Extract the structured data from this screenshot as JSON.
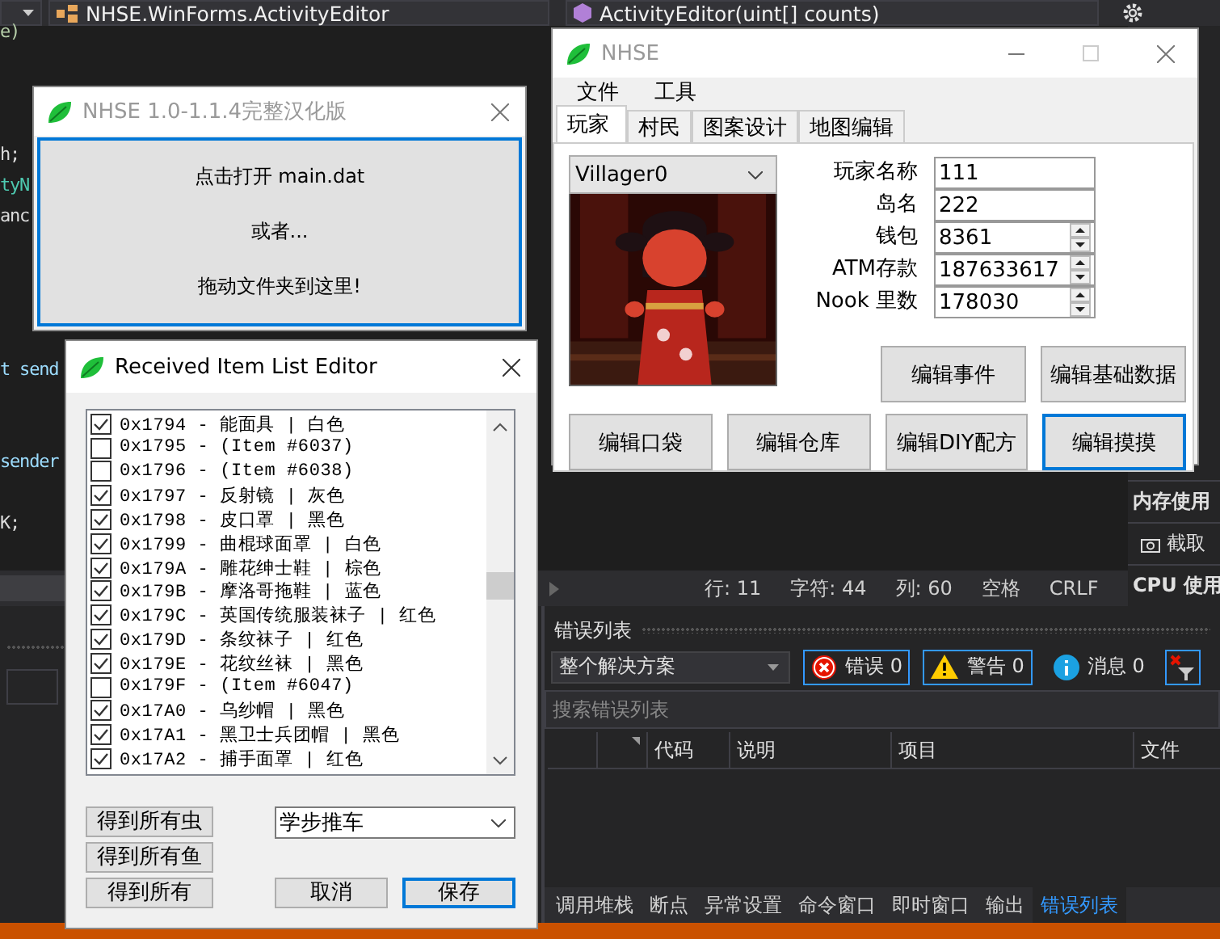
{
  "ide": {
    "nav": {
      "class_combo": "NHSE.WinForms.ActivityEditor",
      "member_combo": "ActivityEditor(uint[] counts)"
    },
    "code_fragments": [
      {
        "text": "e)",
        "kind": "number"
      },
      {
        "text": "h;",
        "kind": "plain"
      },
      {
        "text": "tyN",
        "kind": "type"
      },
      {
        "text": "anc",
        "kind": "plain"
      },
      {
        "text": "t send",
        "kind": "param"
      },
      {
        "text": "sender",
        "kind": "param"
      },
      {
        "text": "K;",
        "kind": "plain"
      }
    ],
    "diagnostics": [
      {
        "text": "内存使用",
        "kind": "header"
      },
      {
        "text": "截取",
        "kind": "action"
      },
      {
        "text": "CPU 使用",
        "kind": "header"
      }
    ],
    "status": [
      "行: 11",
      "字符: 44",
      "列: 60",
      "空格",
      "CRLF"
    ],
    "error_list": {
      "title": "错误列表",
      "scope": "整个解决方案",
      "filters": [
        {
          "kind": "error",
          "label": "错误 0",
          "selected": true
        },
        {
          "kind": "warning",
          "label": "警告 0",
          "selected": true
        },
        {
          "kind": "info",
          "label": "消息 0",
          "selected": false
        }
      ],
      "filter_toggle": {
        "selected": true
      },
      "search": {
        "placeholder": "搜索错误列表"
      },
      "columns": [
        "代码",
        "说明",
        "项目",
        "文件"
      ]
    },
    "bottom_tabs": [
      {
        "label": "调用堆栈",
        "selected": false
      },
      {
        "label": "断点",
        "selected": false
      },
      {
        "label": "异常设置",
        "selected": false
      },
      {
        "label": "命令窗口",
        "selected": false
      },
      {
        "label": "即时窗口",
        "selected": false
      },
      {
        "label": "输出",
        "selected": false
      },
      {
        "label": "错误列表",
        "selected": true
      }
    ]
  },
  "windows": {
    "start": {
      "title": "NHSE 1.0-1.1.4完整汉化版",
      "active": false,
      "lines": [
        "点击打开 main.dat",
        "或者...",
        "拖动文件夹到这里!"
      ]
    },
    "nhse": {
      "title": "NHSE",
      "active": false,
      "menu": [
        "文件",
        "工具"
      ],
      "tabs": [
        {
          "label": "玩家",
          "selected": true
        },
        {
          "label": "村民",
          "selected": false
        },
        {
          "label": "图案设计",
          "selected": false
        },
        {
          "label": "地图编辑",
          "selected": false
        }
      ],
      "villager": "Villager0",
      "fields": [
        {
          "label": "玩家名称",
          "value": "111",
          "kind": "text"
        },
        {
          "label": "岛名",
          "value": "222",
          "kind": "text"
        },
        {
          "label": "钱包",
          "value": "8361",
          "kind": "spin"
        },
        {
          "label": "ATM存款",
          "value": "187633617",
          "kind": "spin"
        },
        {
          "label": "Nook 里数",
          "value": "178030",
          "kind": "spin"
        }
      ],
      "side_buttons": [
        {
          "label": "编辑事件",
          "focused": false
        },
        {
          "label": "编辑基础数据",
          "focused": false
        }
      ],
      "buttons": [
        {
          "label": "编辑口袋",
          "focused": false
        },
        {
          "label": "编辑仓库",
          "focused": false
        },
        {
          "label": "编辑DIY配方",
          "focused": false
        },
        {
          "label": "编辑摸摸",
          "focused": true
        }
      ]
    },
    "item_editor": {
      "title": "Received Item List Editor",
      "active": true,
      "items": [
        {
          "text": "0x1794 - 能面具 | 白色",
          "checked": true
        },
        {
          "text": "0x1795 - (Item #6037)",
          "checked": false
        },
        {
          "text": "0x1796 - (Item #6038)",
          "checked": false
        },
        {
          "text": "0x1797 - 反射镜 | 灰色",
          "checked": true
        },
        {
          "text": "0x1798 - 皮口罩 | 黑色",
          "checked": true
        },
        {
          "text": "0x1799 - 曲棍球面罩 | 白色",
          "checked": true
        },
        {
          "text": "0x179A - 雕花绅士鞋 | 棕色",
          "checked": true
        },
        {
          "text": "0x179B - 摩洛哥拖鞋 | 蓝色",
          "checked": true
        },
        {
          "text": "0x179C - 英国传统服装袜子 | 红色",
          "checked": true
        },
        {
          "text": "0x179D - 条纹袜子 | 红色",
          "checked": true
        },
        {
          "text": "0x179E - 花纹丝袜 | 黑色",
          "checked": true
        },
        {
          "text": "0x179F - (Item #6047)",
          "checked": false
        },
        {
          "text": "0x17A0 - 乌纱帽 | 黑色",
          "checked": true
        },
        {
          "text": "0x17A1 - 黑卫士兵团帽 | 黑色",
          "checked": true
        },
        {
          "text": "0x17A2 - 捕手面罩 | 红色",
          "checked": true
        }
      ],
      "fill_buttons": [
        "得到所有虫",
        "得到所有鱼",
        "得到所有"
      ],
      "combo": "学步推车",
      "buttons": [
        {
          "label": "取消",
          "focused": false
        },
        {
          "label": "保存",
          "focused": true
        }
      ]
    }
  }
}
